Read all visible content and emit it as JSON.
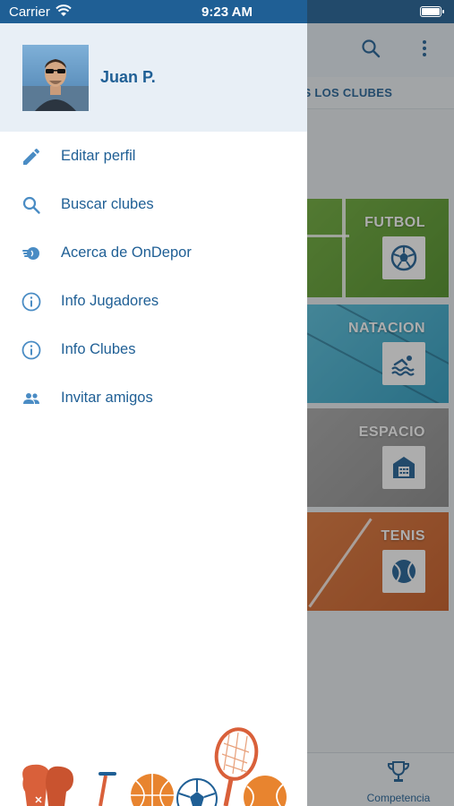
{
  "status_bar": {
    "carrier": "Carrier",
    "time": "9:23 AM"
  },
  "drawer": {
    "user_name": "Juan P.",
    "menu": [
      {
        "label": "Editar perfil",
        "icon": "pencil-icon"
      },
      {
        "label": "Buscar clubes",
        "icon": "search-icon"
      },
      {
        "label": "Acerca de OnDepor",
        "icon": "ondepor-logo-icon"
      },
      {
        "label": "Info Jugadores",
        "icon": "info-icon"
      },
      {
        "label": "Info Clubes",
        "icon": "info-icon"
      },
      {
        "label": "Invitar amigos",
        "icon": "people-icon"
      }
    ]
  },
  "background_app": {
    "tab_label": "TODOS LOS CLUBES",
    "cards": [
      {
        "title": "FUTBOL",
        "icon": "soccer-ball-icon"
      },
      {
        "title": "NATACION",
        "icon": "swimmer-icon"
      },
      {
        "title": "ESPACIO",
        "icon": "building-icon"
      },
      {
        "title": "TENIS",
        "icon": "tennis-ball-icon"
      }
    ],
    "bottom_tab_label": "Competencia"
  },
  "colors": {
    "brand_blue": "#1f5f95",
    "header_bg": "#e8eff6"
  }
}
